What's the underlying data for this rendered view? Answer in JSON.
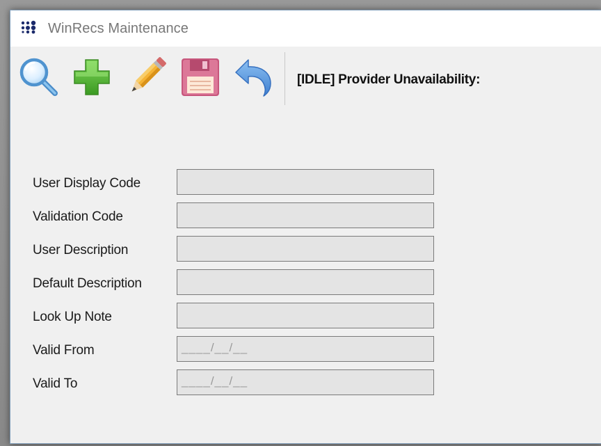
{
  "window": {
    "title": "WinRecs Maintenance",
    "app_icon": "dots-grid-icon"
  },
  "toolbar": {
    "buttons": [
      {
        "name": "search-button",
        "icon": "magnifier-icon",
        "color": "#5a9fd8"
      },
      {
        "name": "add-button",
        "icon": "green-plus-icon",
        "color": "#4caf2c"
      },
      {
        "name": "edit-button",
        "icon": "pencil-icon",
        "color": "#f0a020"
      },
      {
        "name": "save-button",
        "icon": "floppy-disk-icon",
        "color": "#d07090"
      },
      {
        "name": "undo-button",
        "icon": "undo-arrow-icon",
        "color": "#4a86d8"
      }
    ],
    "status_title": "[IDLE] Provider Unavailability:"
  },
  "form": {
    "fields": [
      {
        "label": "User Display Code",
        "value": ""
      },
      {
        "label": "Validation Code",
        "value": ""
      },
      {
        "label": "User Description",
        "value": ""
      },
      {
        "label": "Default Description",
        "value": ""
      },
      {
        "label": "Look Up Note",
        "value": ""
      },
      {
        "label": "Valid From",
        "value": "____/__/__"
      },
      {
        "label": "Valid To",
        "value": "____/__/__"
      }
    ]
  }
}
